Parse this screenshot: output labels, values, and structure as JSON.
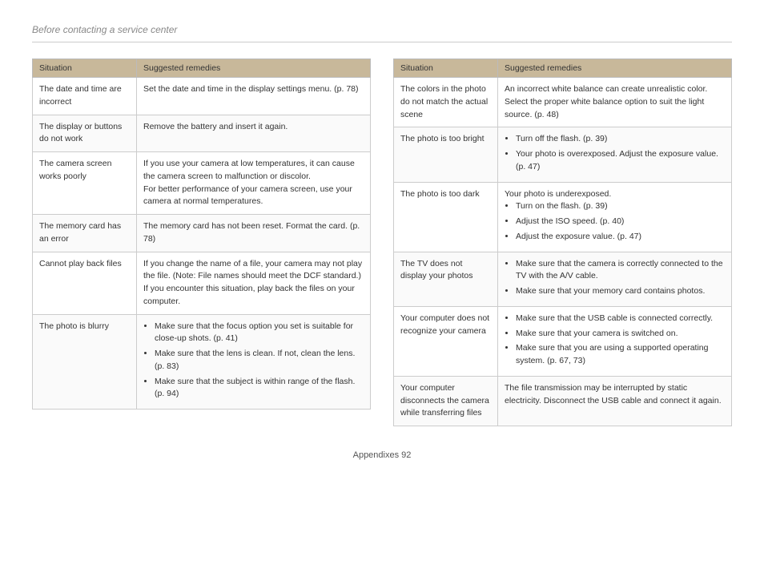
{
  "page": {
    "title": "Before contacting a service center",
    "footer": "Appendixes  92"
  },
  "left_table": {
    "header": {
      "situation": "Situation",
      "remedies": "Suggested remedies"
    },
    "rows": [
      {
        "situation": "The date and time are incorrect",
        "remedy_text": "Set the date and time in the display settings menu. (p. 78)",
        "remedy_list": []
      },
      {
        "situation": "The display or buttons do not work",
        "remedy_text": "Remove the battery and insert it again.",
        "remedy_list": []
      },
      {
        "situation": "The camera screen works poorly",
        "remedy_text": "If you use your camera at low temperatures, it can cause the camera screen to malfunction or discolor.\nFor better performance of your camera screen, use your camera at normal temperatures.",
        "remedy_list": []
      },
      {
        "situation": "The memory card has an error",
        "remedy_text": "The memory card has not been reset. Format the card. (p. 78)",
        "remedy_list": []
      },
      {
        "situation": "Cannot play back files",
        "remedy_text": "If you change the name of a file, your camera may not play the file. (Note: File names should meet the DCF standard.) If you encounter this situation, play back the files on your computer.",
        "remedy_list": []
      },
      {
        "situation": "The photo is blurry",
        "remedy_text": "",
        "remedy_list": [
          "Make sure that the focus option you set is suitable for close-up shots. (p. 41)",
          "Make sure that the lens is clean. If not, clean the lens. (p. 83)",
          "Make sure that the subject is within range of the flash. (p. 94)"
        ]
      }
    ]
  },
  "right_table": {
    "header": {
      "situation": "Situation",
      "remedies": "Suggested remedies"
    },
    "rows": [
      {
        "situation": "The colors in the photo do not match the actual scene",
        "remedy_text": "An incorrect white balance can create unrealistic color. Select the proper white balance option to suit the light source. (p. 48)",
        "remedy_list": []
      },
      {
        "situation": "The photo is too bright",
        "remedy_text": "",
        "remedy_list": [
          "Turn off the flash. (p. 39)",
          "Your photo is overexposed. Adjust the exposure value. (p. 47)"
        ]
      },
      {
        "situation": "The photo is too dark",
        "remedy_text": "Your photo is underexposed.",
        "remedy_list": [
          "Turn on the flash. (p. 39)",
          "Adjust the ISO speed. (p. 40)",
          "Adjust the exposure value. (p. 47)"
        ]
      },
      {
        "situation": "The TV does not display your photos",
        "remedy_text": "",
        "remedy_list": [
          "Make sure that the camera is correctly connected to the TV with the A/V cable.",
          "Make sure that your memory card contains photos."
        ]
      },
      {
        "situation": "Your computer does not recognize your camera",
        "remedy_text": "",
        "remedy_list": [
          "Make sure that the USB cable is connected correctly.",
          "Make sure that your camera is switched on.",
          "Make sure that you are using a supported operating system. (p. 67, 73)"
        ]
      },
      {
        "situation": "Your computer disconnects the camera while transferring files",
        "remedy_text": "The file transmission may be interrupted by static electricity. Disconnect the USB cable and connect it again.",
        "remedy_list": []
      }
    ]
  }
}
